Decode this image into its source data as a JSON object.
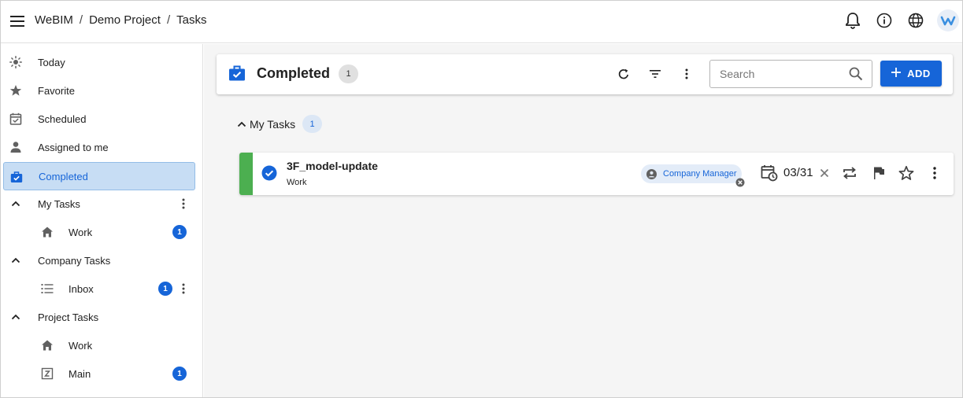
{
  "header": {
    "breadcrumb": [
      "WeBIM",
      "Demo Project",
      "Tasks"
    ],
    "separator": "/"
  },
  "sidebar": {
    "items": [
      {
        "label": "Today",
        "icon": "sun-icon"
      },
      {
        "label": "Favorite",
        "icon": "star-icon"
      },
      {
        "label": "Scheduled",
        "icon": "calendar-check-icon"
      },
      {
        "label": "Assigned to me",
        "icon": "person-icon"
      },
      {
        "label": "Completed",
        "icon": "briefcase-check-icon",
        "active": true
      }
    ],
    "groups": [
      {
        "label": "My Tasks",
        "children": [
          {
            "label": "Work",
            "icon": "home-icon",
            "count": "1"
          }
        ]
      },
      {
        "label": "Company Tasks",
        "children": [
          {
            "label": "Inbox",
            "icon": "list-icon",
            "count": "1"
          }
        ]
      },
      {
        "label": "Project Tasks",
        "children": [
          {
            "label": "Work",
            "icon": "home-icon"
          },
          {
            "label": "Main",
            "icon": "z-box-icon",
            "count": "1"
          }
        ]
      }
    ]
  },
  "toolbar": {
    "title": "Completed",
    "count": "1",
    "search_placeholder": "Search",
    "add_label": "ADD"
  },
  "group": {
    "label": "My Tasks",
    "count": "1"
  },
  "task": {
    "name": "3F_model-update",
    "list": "Work",
    "assignee": "Company Manager",
    "due": "03/31",
    "status_color": "#4caf50"
  },
  "colors": {
    "accent": "#1665d8",
    "active_bg": "#c7ddf4"
  }
}
